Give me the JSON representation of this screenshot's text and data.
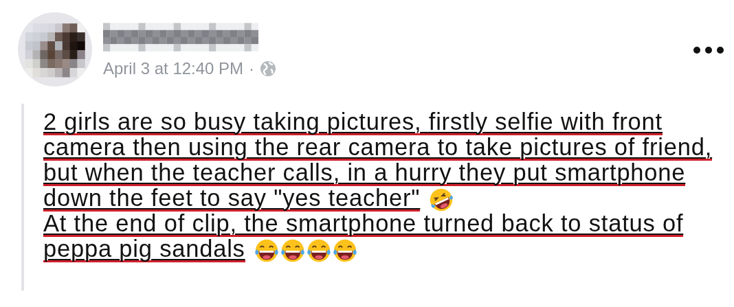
{
  "post": {
    "timestamp": "April 3 at 12:40 PM",
    "separator": "·",
    "paragraphs": [
      {
        "lines": [
          {
            "text": "2 girls are so busy taking pictures, firstly selfie with front"
          },
          {
            "text": "camera then using the rear camera to take pictures of friend,"
          },
          {
            "text": "but when the teacher calls, in a hurry they put smartphone"
          },
          {
            "text": "down the feet to say \"yes teacher\"",
            "emojis": [
              {
                "kind": "rofl"
              }
            ]
          }
        ]
      },
      {
        "lines": [
          {
            "text": "At the end of clip, the smartphone turned back to status of"
          },
          {
            "text": "peppa pig sandals",
            "emojis": [
              {
                "kind": "joy"
              },
              {
                "kind": "joy"
              },
              {
                "kind": "joy"
              },
              {
                "kind": "joy"
              }
            ]
          }
        ]
      }
    ]
  }
}
